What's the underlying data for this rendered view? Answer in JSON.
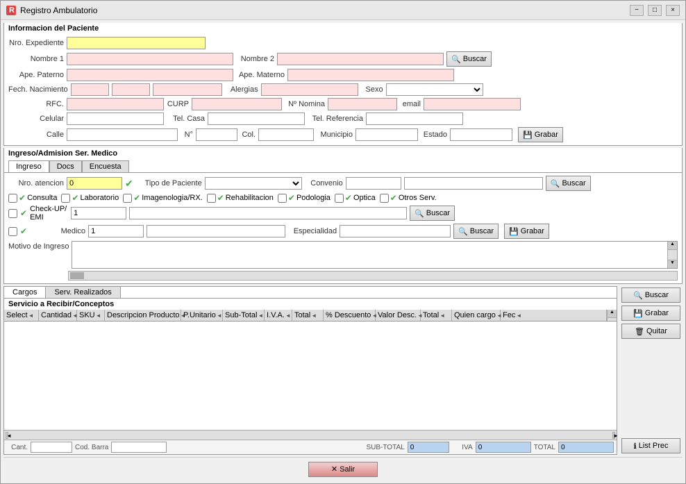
{
  "window": {
    "title": "Registro Ambulatorio",
    "min": "−",
    "max": "□",
    "close": "×"
  },
  "patient": {
    "section_title": "Informacion del Paciente",
    "labels": {
      "nro_expediente": "Nro. Expediente",
      "nombre1": "Nombre 1",
      "nombre2": "Nombre 2",
      "ape_paterno": "Ape. Paterno",
      "ape_materno": "Ape. Materno",
      "fech_nac": "Fech. Nacimiento",
      "alergias": "Alergias",
      "sexo": "Sexo",
      "rfc": "RFC.",
      "curp": "CURP",
      "nomina": "Nº Nomina",
      "email": "email",
      "celular": "Celular",
      "tel_casa": "Tel. Casa",
      "tel_ref": "Tel. Referencia",
      "calle": "Calle",
      "no": "N°",
      "col": "Col.",
      "municipio": "Municipio",
      "estado": "Estado"
    },
    "buttons": {
      "buscar": "Buscar",
      "grabar": "Grabar"
    }
  },
  "admission": {
    "section_title": "Ingreso/Admision Ser. Medico",
    "tabs": [
      "Ingreso",
      "Docs",
      "Encuesta"
    ],
    "labels": {
      "nro_atencion": "Nro. atencion",
      "tipo_paciente": "Tipo de Paciente",
      "convenio": "Convenio",
      "medico": "Medico",
      "especialidad": "Especialidad",
      "motivo": "Motivo de Ingreso"
    },
    "nro_atencion_val": "0",
    "medico_val": "1",
    "check_up_val": "1",
    "services": [
      "Consulta",
      "Laboratorio",
      "Imagenologia/RX.",
      "Rehabilitacion",
      "Podologia",
      "Optica",
      "Otros Serv."
    ],
    "buttons": {
      "buscar": "Buscar",
      "buscar2": "Buscar",
      "grabar": "Grabar"
    },
    "check_up_label": "Check-UP/\nEMI"
  },
  "bottom": {
    "tabs": [
      "Cargos",
      "Serv. Realizados"
    ],
    "section_label": "Servicio a Recibir/Conceptos",
    "columns": [
      "Select",
      "Cantidad",
      "SKU",
      "Descripcion Producto",
      "P.Unitario",
      "Sub-Total",
      "I.V.A.",
      "Total",
      "% Descuento",
      "Valor Desc.",
      "Total",
      "Quien cargo",
      "Fec"
    ],
    "totals": {
      "cant_label": "Cant.",
      "cod_barra_label": "Cod. Barra",
      "subtotal_label": "SUB-TOTAL",
      "subtotal_val": "0",
      "iva_label": "IVA",
      "iva_val": "0",
      "total_label": "TOTAL",
      "total_val": "0"
    },
    "buttons": {
      "buscar": "Buscar",
      "grabar": "Grabar",
      "quitar": "Quitar",
      "list_prec": "List Prec"
    }
  },
  "footer": {
    "salir": "Salir"
  }
}
